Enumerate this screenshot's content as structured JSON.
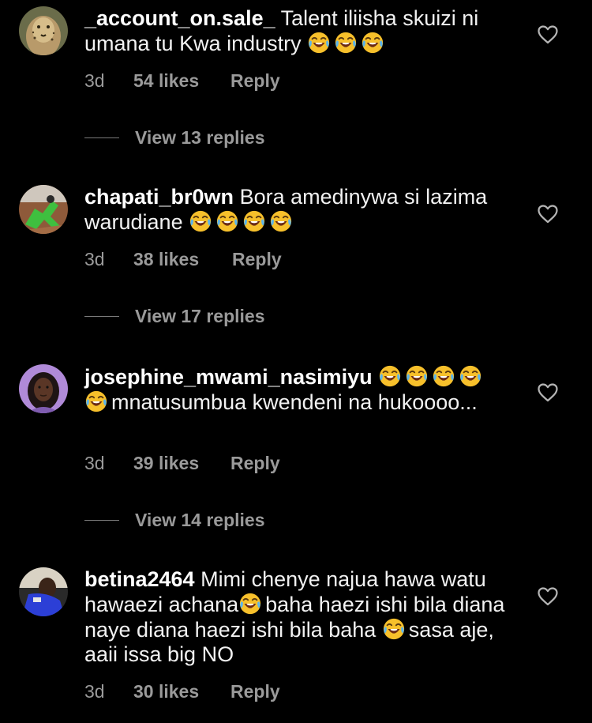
{
  "comments": [
    {
      "username": "_account_on.sale_",
      "text_parts": [
        "Talent iliisha skuizi ni umana tu Kwa industry"
      ],
      "time": "3d",
      "likes": "54 likes",
      "reply_label": "Reply",
      "view_replies": "View 13 replies",
      "avatar": "avatar-cheetah"
    },
    {
      "username": "chapati_br0wn",
      "text_parts": [
        "Bora amedinywa si lazima warudiane"
      ],
      "time": "3d",
      "likes": "38 likes",
      "reply_label": "Reply",
      "view_replies": "View 17 replies",
      "avatar": "avatar-green-figure"
    },
    {
      "username": "josephine_mwami_nasimiyu",
      "text_parts": [
        "mnatusumbua kwendeni na hukoooo..."
      ],
      "time": "3d",
      "likes": "39 likes",
      "reply_label": "Reply",
      "view_replies": "View 14 replies",
      "avatar": "avatar-portrait-purple"
    },
    {
      "username": "betina2464",
      "text_parts": [
        "Mimi chenye najua hawa watu hawaezi achana",
        "baha haezi ishi bila diana naye diana haezi ishi bila baha",
        "sasa aje, aaii issa big NO"
      ],
      "time": "3d",
      "likes": "30 likes",
      "reply_label": "Reply",
      "view_replies": "",
      "avatar": "avatar-portrait-blue"
    }
  ],
  "icons": {
    "like": "heart-outline-icon",
    "emoji": "face-with-tears-of-joy-icon"
  },
  "colors": {
    "background": "#000000",
    "text": "#f2f2f2",
    "secondary": "#9a9a9a",
    "emoji_yellow": "#f7c02b"
  }
}
